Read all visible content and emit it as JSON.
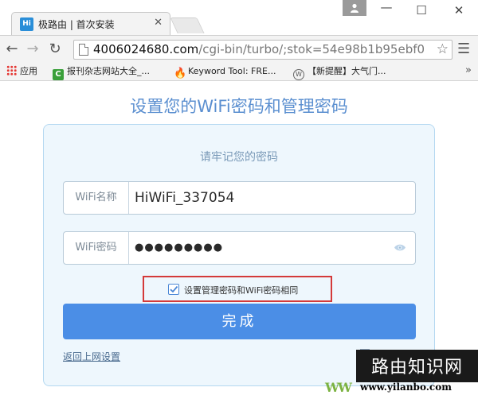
{
  "browser": {
    "tab_title": "极路由 | 首次安装",
    "tab_favicon_text": "Hi",
    "url_host": "4006024680.com",
    "url_path": "/cgi-bin/turbo/;stok=54e98b1b95ebf0",
    "bookmarks": [
      {
        "label": "应用",
        "icon": "apps-grid-icon"
      },
      {
        "label": "报刊杂志网站大全_...",
        "icon": "c-bookmark-icon",
        "icon_text": "C"
      },
      {
        "label": "Keyword Tool: FRE...",
        "icon": "keyword-tool-icon",
        "icon_text": "🔥"
      },
      {
        "label": "【新提醒】大气门...",
        "icon": "wordpress-icon",
        "icon_text": "W"
      }
    ]
  },
  "page": {
    "heading": "设置您的WiFi密码和管理密码",
    "card_subtitle": "请牢记您的密码",
    "ssid_label": "WiFi名称",
    "ssid_value": "HiWiFi_337054",
    "password_label": "WiFi密码",
    "password_masked": "●●●●●●●●●",
    "same_password_label": "设置管理密码和WiFi密码相同",
    "same_password_checked": true,
    "done_button": "完成",
    "back_link": "返回上网设置"
  },
  "watermark": {
    "title": "路由知识网",
    "url": "www.yilanbo.com",
    "green_text": "WW"
  },
  "colors": {
    "accent_blue": "#4b8ee6",
    "heading_blue": "#5b8fd0",
    "card_bg": "#eef7fd",
    "highlight_red": "#d43a3a"
  }
}
